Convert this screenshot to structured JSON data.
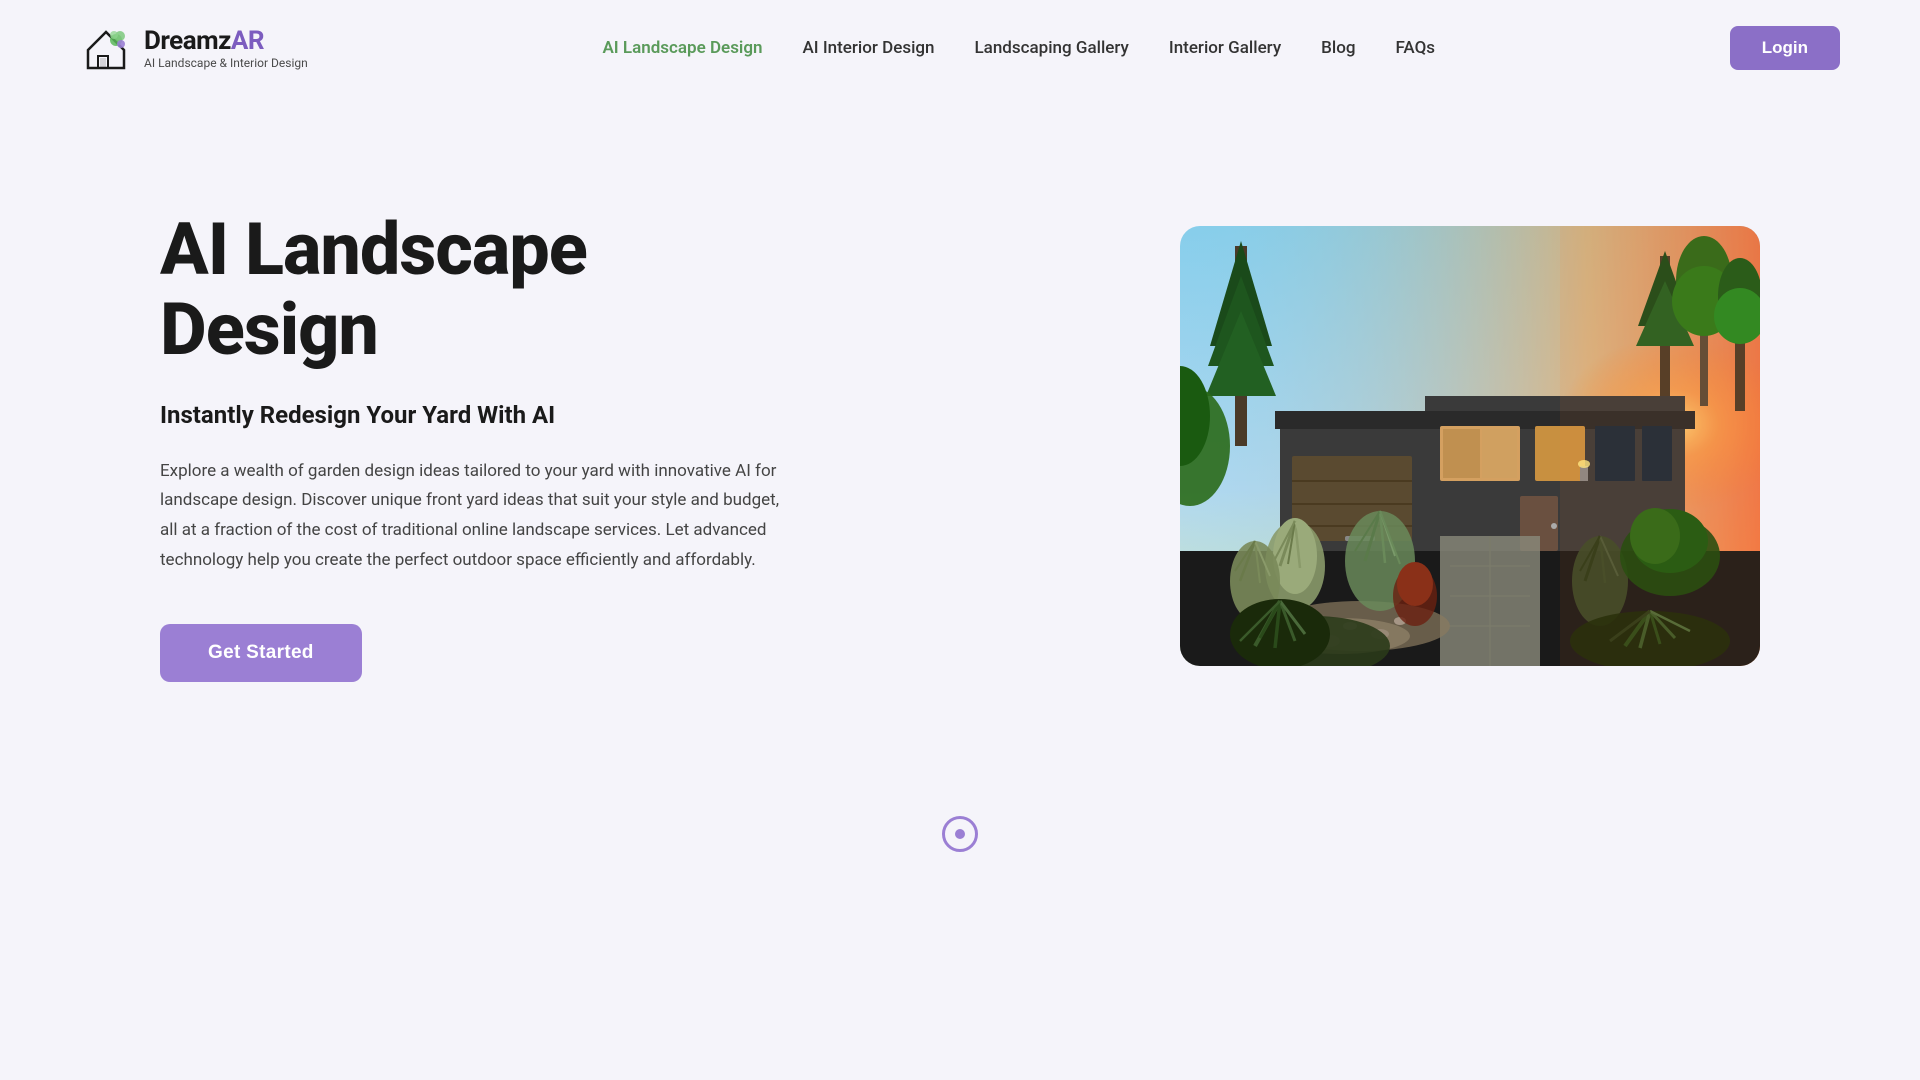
{
  "colors": {
    "accent_purple": "#9b7fd4",
    "nav_active_green": "#5a9a5a",
    "bg": "#f5f4fa",
    "text_dark": "#1a1a1a",
    "text_muted": "#444"
  },
  "logo": {
    "name_part1": "Dreamz",
    "name_part2": "AR",
    "tagline": "AI Landscape & Interior Design"
  },
  "nav": {
    "items": [
      {
        "label": "AI Landscape Design",
        "active": true
      },
      {
        "label": "AI Interior Design",
        "active": false
      },
      {
        "label": "Landscaping Gallery",
        "active": false
      },
      {
        "label": "Interior Gallery",
        "active": false
      },
      {
        "label": "Blog",
        "active": false
      },
      {
        "label": "FAQs",
        "active": false
      }
    ],
    "login_label": "Login"
  },
  "hero": {
    "title": "AI Landscape Design",
    "subtitle": "Instantly Redesign Your Yard With AI",
    "description": "Explore a wealth of garden design ideas tailored to your yard with innovative AI for landscape design. Discover unique front yard ideas that suit your style and budget, all at a fraction of the cost of traditional online landscape services. Let advanced technology help you create the perfect outdoor space efficiently and affordably.",
    "cta_label": "Get Started"
  },
  "scroll": {
    "indicator": "scroll-down"
  }
}
